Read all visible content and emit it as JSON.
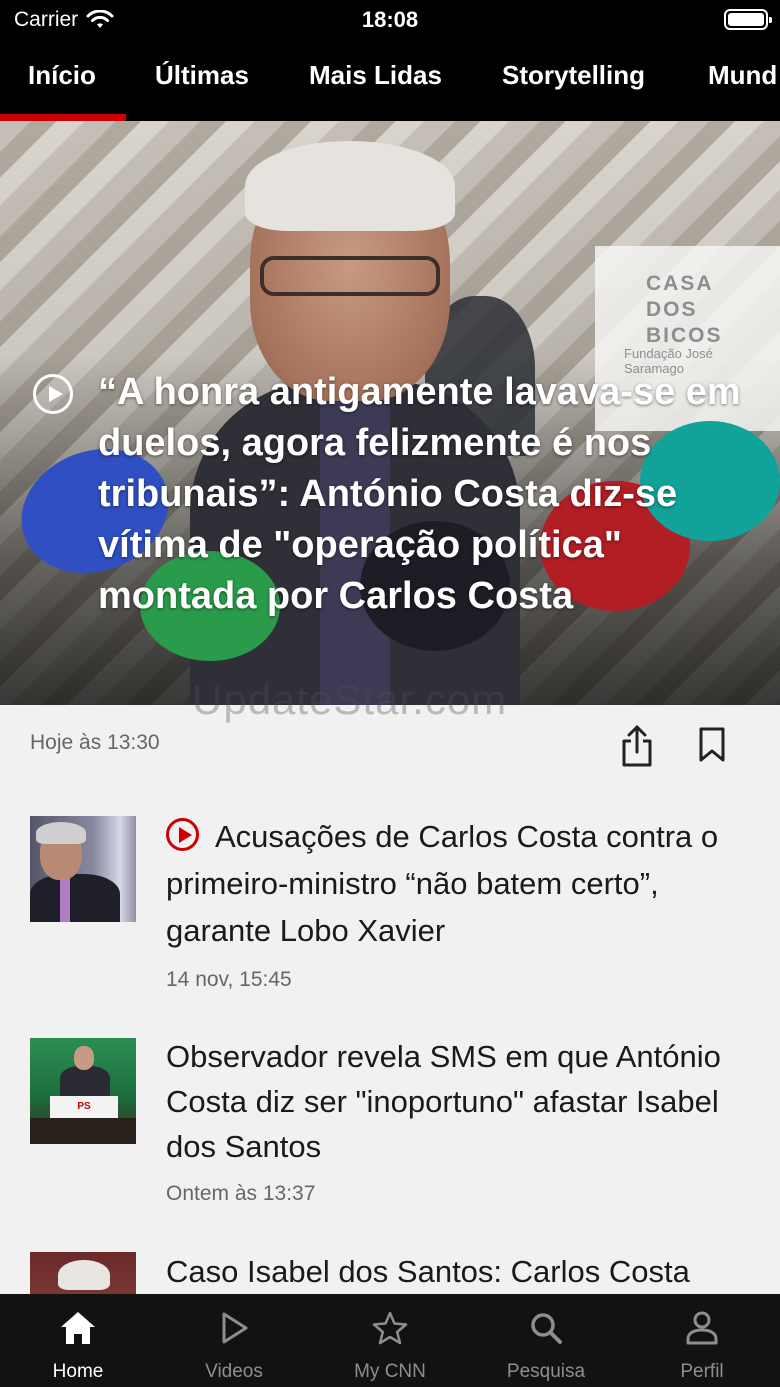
{
  "status_bar": {
    "carrier": "Carrier",
    "time": "18:08"
  },
  "nav": {
    "tabs": [
      {
        "label": "Início",
        "active": true
      },
      {
        "label": "Últimas"
      },
      {
        "label": "Mais Lidas"
      },
      {
        "label": "Storytelling"
      },
      {
        "label": "Mund"
      }
    ]
  },
  "hero": {
    "title": "“A honra antigamente lavava-se em duelos, agora felizmente é nos tribunais”: António Costa diz-se vítima de \"operação política\" montada por Carlos Costa",
    "sign_title": "CASA DOS BICOS",
    "sign_subtitle": "Fundação José Saramago",
    "timestamp": "Hoje às 13:30",
    "has_video": true
  },
  "watermark": "UpdateStar.com",
  "articles": [
    {
      "title": "Acusações de Carlos Costa contra o primeiro-ministro “não batem certo”, garante Lobo Xavier",
      "time": "14 nov, 15:45",
      "has_video": true
    },
    {
      "title": "Observador revela SMS em que António Costa diz ser \"inoportuno\" afastar Isabel dos Santos",
      "time": "Ontem às 13:37",
      "has_video": false,
      "thumb_podium": "PS"
    },
    {
      "title": "Caso Isabel dos Santos: Carlos Costa",
      "time": "",
      "has_video": false
    }
  ],
  "tab_bar": {
    "items": [
      {
        "label": "Home",
        "icon": "home-icon",
        "active": true
      },
      {
        "label": "Videos",
        "icon": "play-icon"
      },
      {
        "label": "My CNN",
        "icon": "star-icon"
      },
      {
        "label": "Pesquisa",
        "icon": "search-icon"
      },
      {
        "label": "Perfil",
        "icon": "person-icon"
      }
    ]
  },
  "colors": {
    "accent": "#cc0000",
    "nav_bg": "#000000",
    "tab_bar_bg": "#121212",
    "page_bg": "#f1f1f1"
  }
}
